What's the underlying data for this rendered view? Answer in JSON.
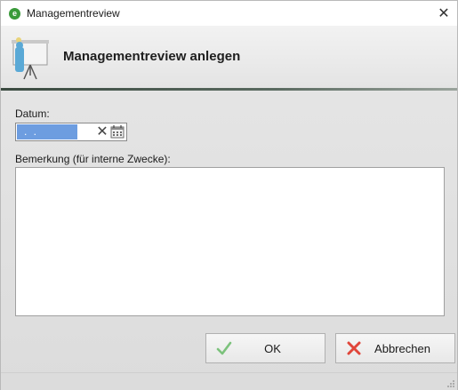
{
  "window": {
    "title": "Managementreview",
    "close_glyph": "✕",
    "app_icon": "e"
  },
  "header": {
    "title": "Managementreview anlegen",
    "icon": "presentation-board-icon"
  },
  "form": {
    "date_label": "Datum:",
    "date_value": ". .",
    "clear_glyph": "✕",
    "remark_label": "Bemerkung (für interne Zwecke):",
    "remark_value": ""
  },
  "buttons": {
    "ok_label": "OK",
    "cancel_label": "Abbrechen"
  },
  "colors": {
    "ok_check": "#7cc27c",
    "cancel_x": "#e0463a",
    "date_selection": "#6d9de0",
    "header_line": "#3a4a40"
  }
}
